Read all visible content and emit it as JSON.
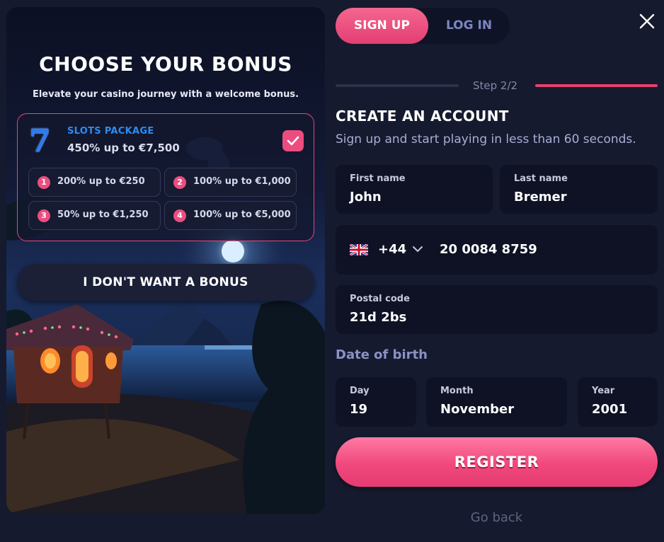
{
  "bonus": {
    "title": "CHOOSE YOUR BONUS",
    "subtitle": "Elevate your casino journey with a welcome bonus.",
    "package": {
      "icon": "seven-slot-icon",
      "icon_glyph": "7",
      "name": "SLOTS PACKAGE",
      "amount": "450% up to €7,500",
      "selected": true
    },
    "tiers": [
      {
        "number": "1",
        "label": "200% up to €250"
      },
      {
        "number": "2",
        "label": "100% up to €1,000"
      },
      {
        "number": "3",
        "label": "50% up to €1,250"
      },
      {
        "number": "4",
        "label": "100% up to €5,000"
      }
    ],
    "no_bonus_label": "I DON'T WANT A BONUS"
  },
  "auth": {
    "signup_tab": "SIGN UP",
    "login_tab": "LOG IN",
    "active_tab": "signup"
  },
  "step": {
    "label": "Step 2/2",
    "current": 2,
    "total": 2
  },
  "form": {
    "title": "CREATE AN ACCOUNT",
    "subtitle": "Sign up and start playing in less than 60 seconds.",
    "first_name": {
      "label": "First name",
      "value": "John"
    },
    "last_name": {
      "label": "Last name",
      "value": "Bremer"
    },
    "phone": {
      "flag": "uk-flag-icon",
      "code": "+44",
      "number": "20 0084 8759"
    },
    "postal_code": {
      "label": "Postal code",
      "value": "21d 2bs"
    },
    "dob_title": "Date of birth",
    "day": {
      "label": "Day",
      "value": "19"
    },
    "month": {
      "label": "Month",
      "value": "November"
    },
    "year": {
      "label": "Year",
      "value": "2001"
    },
    "register_label": "REGISTER",
    "go_back_label": "Go back"
  },
  "colors": {
    "background": "#151a2e",
    "accent_pink": "#ec4d7f",
    "package_blue": "#2d8cf0",
    "field_bg": "#0e1224",
    "muted_text": "#8288a6"
  }
}
